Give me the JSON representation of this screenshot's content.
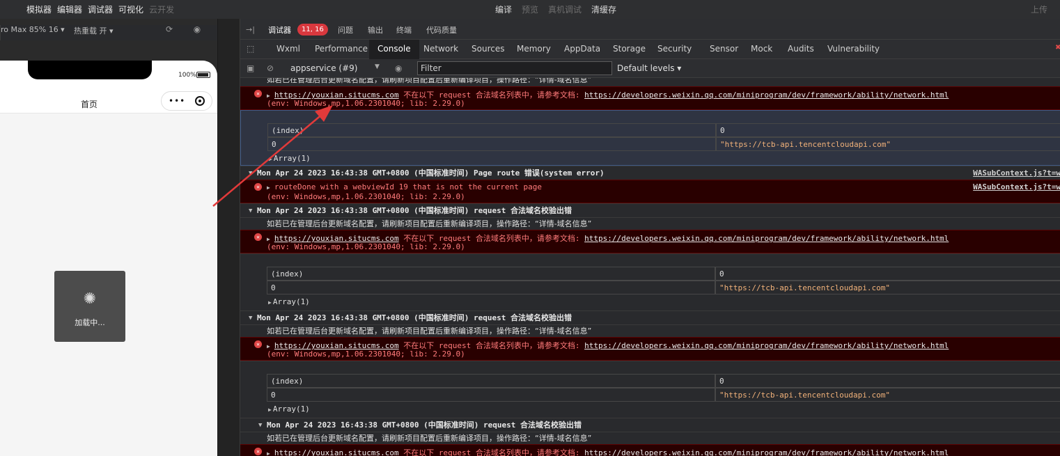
{
  "menubar": {
    "items": [
      "模拟器",
      "编辑器",
      "调试器",
      "可视化",
      "云开发"
    ],
    "center": [
      "编译",
      "预览",
      "真机调试",
      "清缓存"
    ],
    "upload": "上传"
  },
  "simulator": {
    "device": "ro Max 85% 16 ▾",
    "hot_reload": "热重载 开 ▾",
    "battery_pct": "100%",
    "page_title": "首页",
    "capsule_dots": "•••",
    "loading_text": "加载中..."
  },
  "devtools": {
    "panel_tabs": [
      "调试器",
      "问题",
      "输出",
      "终端",
      "代码质量"
    ],
    "badge": "11, 16",
    "tool_tabs": [
      "Wxml",
      "Performance",
      "Console",
      "Network",
      "Sources",
      "Memory",
      "AppData",
      "Storage",
      "Security",
      "Sensor",
      "Mock",
      "Audits",
      "Vulnerability"
    ],
    "active_tab": "Console",
    "context": "appservice (#9)",
    "filter_placeholder": "Filter",
    "levels": "Default levels ▾"
  },
  "console": {
    "info_text": "如若已在管理后台更新域名配置，请刷新项目配置后重新编译项目，操作路径：“详情-域名信息”",
    "err_domain_link": "https://youxian.situcms.com",
    "err_domain_msg": " 不在以下 request 合法域名列表中，请参考文档: ",
    "err_doc_link": "https://developers.weixin.qq.com/miniprogram/dev/framework/ability/network.html",
    "env": "(env: Windows,mp,1.06.2301040; lib: 2.29.0)",
    "table_index": "(index)",
    "table_col0": "0",
    "table_row_key": "0",
    "table_row_val": "\"https://tcb-api.tencentcloudapi.com\"",
    "array_label": "Array(1)",
    "hdr_route": "Mon Apr 24 2023 16:43:38 GMT+0800 (中国标准时间) Page route 错误(system error)",
    "hdr_request": "Mon Apr 24 2023 16:43:38 GMT+0800 (中国标准时间) request 合法域名校验出错",
    "route_err": "routeDone with a webviewId 19 that is not the current page",
    "file_link": "WASubContext.js?t=w"
  }
}
